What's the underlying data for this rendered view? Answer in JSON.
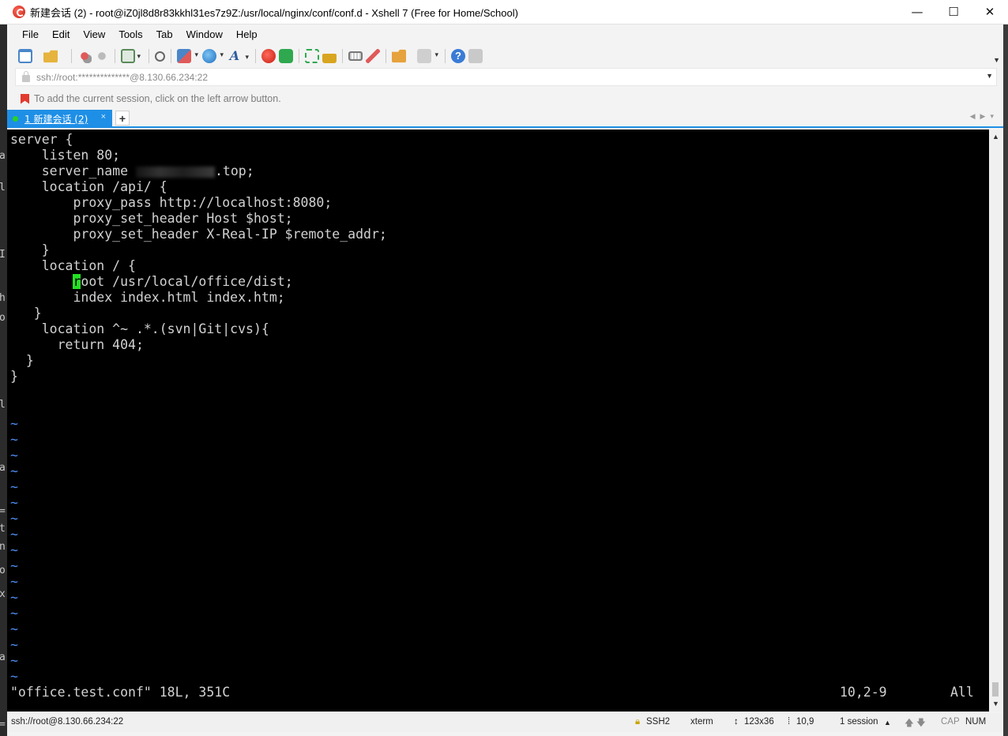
{
  "window": {
    "title": "新建会话 (2) - root@iZ0jl8d8r83kkhl31es7z9Z:/usr/local/nginx/conf/conf.d - Xshell 7 (Free for Home/School)",
    "minimize": "—",
    "maximize": "☐",
    "close": "✕"
  },
  "menu": [
    "File",
    "Edit",
    "View",
    "Tools",
    "Tab",
    "Window",
    "Help"
  ],
  "address": {
    "url": "ssh://root:**************@8.130.66.234:22"
  },
  "hint": {
    "text": "To add the current session, click on the left arrow button."
  },
  "tab": {
    "label": "1 新建会话 (2)",
    "close": "×",
    "add": "+"
  },
  "terminal": {
    "lines": [
      "server {",
      "    listen 80;",
      "    server_name ",
      "    location /api/ {",
      "        proxy_pass http://localhost:8080;",
      "        proxy_set_header Host $host;",
      "        proxy_set_header X-Real-IP $remote_addr;",
      "    }",
      "    location / {",
      "        ",
      "        index index.html index.htm;",
      "   }",
      "    location ^~ .*.(svn|Git|cvs){",
      "      return 404;",
      "  }",
      "}"
    ],
    "server_name_suffix": ".top;",
    "cursor_char": "r",
    "cursor_rest": "oot /usr/local/office/dist;",
    "tilde": "~",
    "status_file": "\"office.test.conf\" 18L, 351C",
    "status_pos": "10,2-9",
    "status_all": "All"
  },
  "statusbar": {
    "connection": "ssh://root@8.130.66.234:22",
    "protocol": "SSH2",
    "term": "xterm",
    "size": "123x36",
    "cursor": "10,9",
    "sessions": "1 session",
    "cap": "CAP",
    "num": "NUM"
  },
  "colors": {
    "tab_blue": "#1e8fe6",
    "cursor_green": "#24e024",
    "tilde_blue": "#4b8cf0"
  }
}
